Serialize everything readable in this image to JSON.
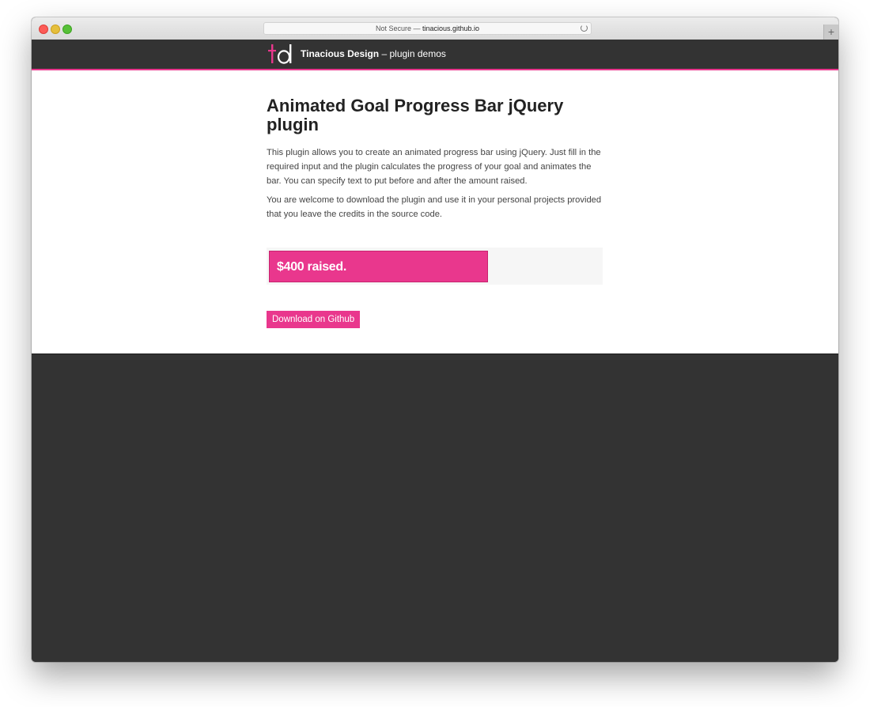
{
  "browser": {
    "url_prefix": "Not Secure — ",
    "url_domain": "tinacious.github.io",
    "new_tab": "+"
  },
  "header": {
    "brand": "Tinacious Design",
    "subtitle": " – plugin demos",
    "logo_colors": {
      "t": "#e9378d",
      "d": "#ffffff"
    }
  },
  "main": {
    "title": "Animated Goal Progress Bar jQuery plugin",
    "paragraphs": [
      "This plugin allows you to create an animated progress bar using jQuery. Just fill in the required input and the plugin calculates the progress of your goal and animates the bar. You can specify text to put before and after the amount raised.",
      "You are welcome to download the plugin and use it in your personal projects provided that you leave the credits in the source code."
    ],
    "progress": {
      "label": "$400 raised.",
      "fraction": 0.66
    },
    "download_label": "Download on Github"
  },
  "colors": {
    "accent": "#e9378d",
    "dark": "#333333",
    "track": "#f6f6f6"
  }
}
